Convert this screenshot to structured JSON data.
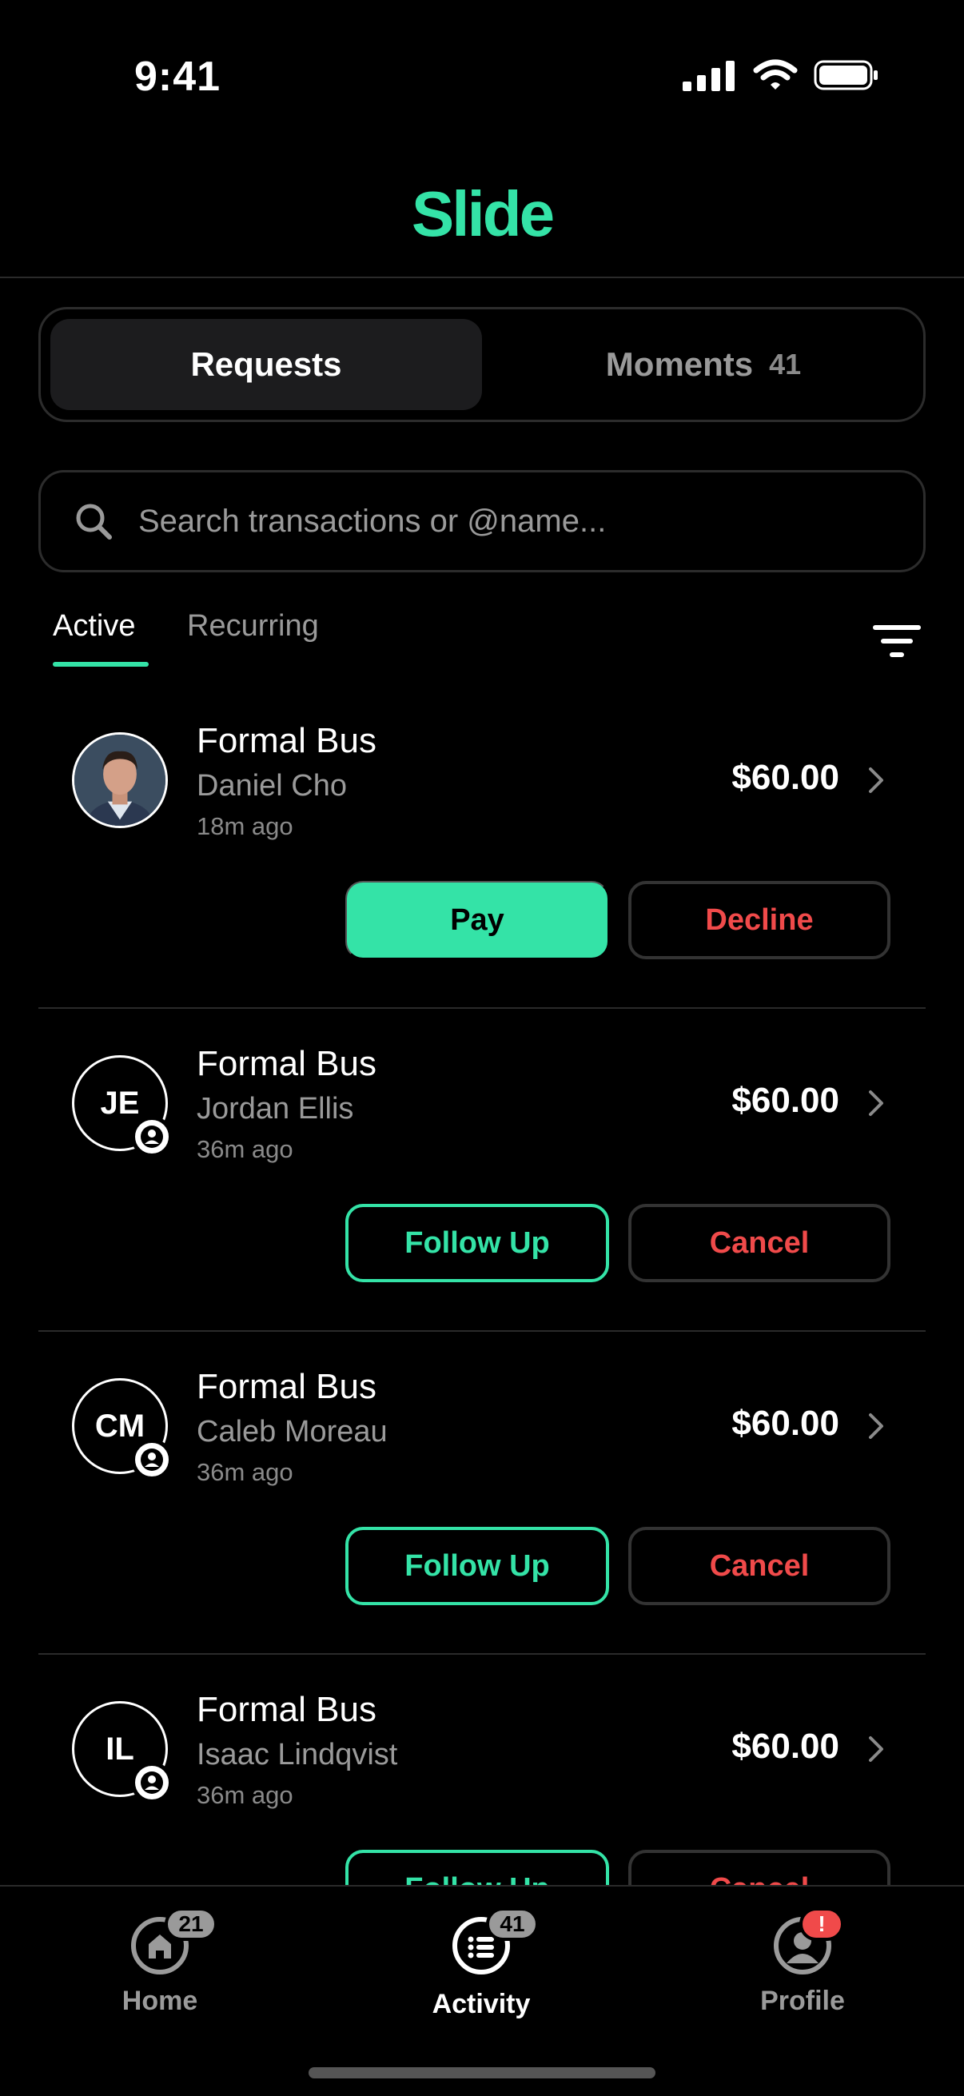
{
  "status": {
    "time": "9:41"
  },
  "header": {
    "logo": "Slide",
    "brand_color": "#34e3a7"
  },
  "segments": {
    "requests": "Requests",
    "moments": "Moments",
    "moments_count": "41"
  },
  "search": {
    "placeholder": "Search transactions or @name..."
  },
  "filters": {
    "active": "Active",
    "recurring": "Recurring"
  },
  "requests": [
    {
      "title": "Formal Bus",
      "name": "Daniel Cho",
      "time": "18m ago",
      "amount": "$60.00",
      "avatar": "photo",
      "primary": "Pay",
      "secondary": "Decline"
    },
    {
      "title": "Formal Bus",
      "name": "Jordan Ellis",
      "time": "36m ago",
      "amount": "$60.00",
      "initials": "JE",
      "primary": "Follow Up",
      "secondary": "Cancel"
    },
    {
      "title": "Formal Bus",
      "name": "Caleb Moreau",
      "time": "36m ago",
      "amount": "$60.00",
      "initials": "CM",
      "primary": "Follow Up",
      "secondary": "Cancel"
    },
    {
      "title": "Formal Bus",
      "name": "Isaac Lindqvist",
      "time": "36m ago",
      "amount": "$60.00",
      "initials": "IL",
      "primary": "Follow Up",
      "secondary": "Cancel"
    }
  ],
  "tabbar": {
    "home": {
      "label": "Home",
      "badge": "21"
    },
    "activity": {
      "label": "Activity",
      "badge": "41"
    },
    "profile": {
      "label": "Profile",
      "badge": "!"
    }
  }
}
